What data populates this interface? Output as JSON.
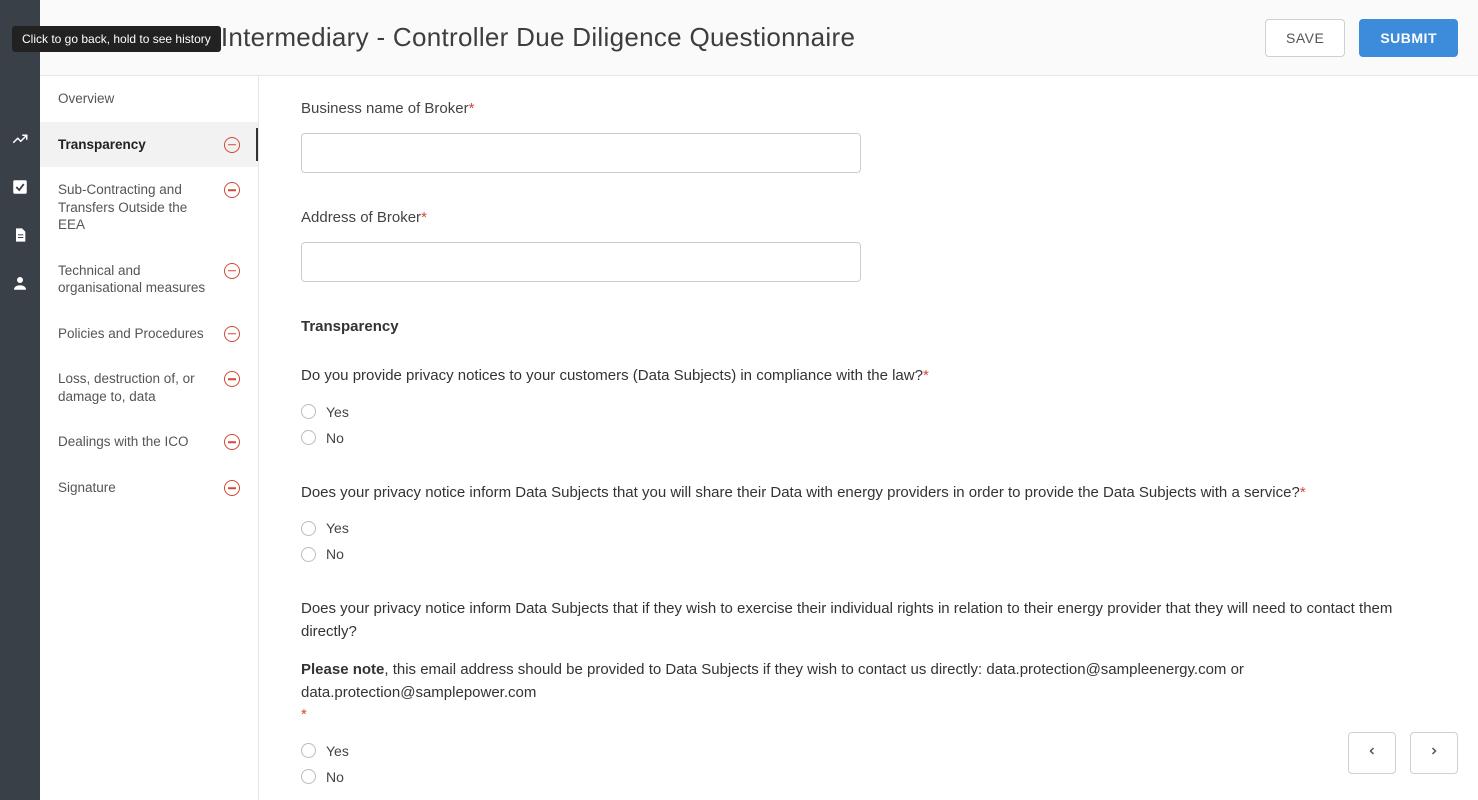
{
  "tooltip": "Click to go back, hold to see history",
  "header": {
    "title": "y Intermediary - Controller Due Diligence Questionnaire",
    "save_label": "SAVE",
    "submit_label": "SUBMIT"
  },
  "rail_icons": [
    "chart-line-icon",
    "check-square-icon",
    "document-icon",
    "user-icon"
  ],
  "sidenav": {
    "items": [
      {
        "label": "Overview",
        "status": "none",
        "active": false
      },
      {
        "label": "Transparency",
        "status": "incomplete",
        "active": true
      },
      {
        "label": "Sub-Contracting and Transfers Outside the EEA",
        "status": "incomplete",
        "active": false
      },
      {
        "label": "Technical and organisational measures",
        "status": "incomplete",
        "active": false
      },
      {
        "label": "Policies and Procedures",
        "status": "incomplete",
        "active": false
      },
      {
        "label": "Loss, destruction of, or damage to, data",
        "status": "incomplete",
        "active": false
      },
      {
        "label": "Dealings with the ICO",
        "status": "incomplete",
        "active": false
      },
      {
        "label": "Signature",
        "status": "incomplete",
        "active": false
      }
    ]
  },
  "form": {
    "business_name": {
      "label": "Business name of Broker",
      "value": ""
    },
    "address": {
      "label": "Address of Broker",
      "value": ""
    },
    "section_heading": "Transparency",
    "options": {
      "yes": "Yes",
      "no": "No"
    },
    "q1": {
      "text": "Do you provide privacy notices to your customers (Data Subjects) in compliance with the law?"
    },
    "q2": {
      "text": "Does your privacy notice inform Data Subjects that you will share their Data with energy providers in order to provide the Data Subjects with a service?"
    },
    "q3": {
      "text": "Does your privacy notice inform Data Subjects that if they wish to exercise their individual rights in relation to their energy provider that they will need to contact them directly?",
      "note_strong": "Please note",
      "note_rest": ", this email address should be provided to Data Subjects if they wish to contact us directly: data.protection@sampleenergy.com or data.protection@samplepower.com"
    }
  }
}
